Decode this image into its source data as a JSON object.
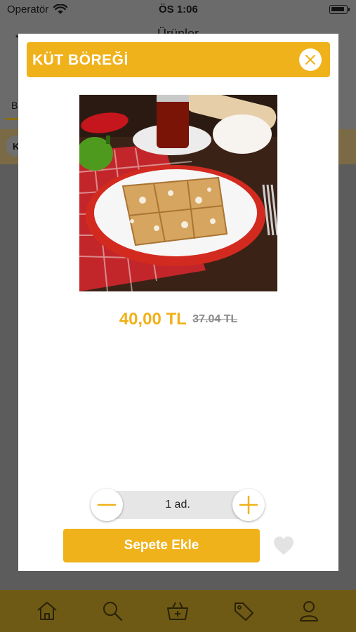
{
  "status_bar": {
    "carrier": "Operatör",
    "time": "ÖS 1:06"
  },
  "background": {
    "nav_title": "Ürünler",
    "tab_letter": "B",
    "chip_letter": "K"
  },
  "tab_bar": {
    "items": [
      {
        "icon": "home-icon"
      },
      {
        "icon": "search-icon"
      },
      {
        "icon": "basket-icon"
      },
      {
        "icon": "tag-icon"
      },
      {
        "icon": "user-icon"
      }
    ]
  },
  "modal": {
    "title": "KÜT BÖREĞİ",
    "price": "40,00 TL",
    "old_price": "37.04 TL",
    "quantity": "1 ad.",
    "add_to_cart_label": "Sepete Ekle"
  },
  "colors": {
    "accent": "#f0b21b",
    "overlay": "#5c5c5c",
    "old_price": "#8a8a8a"
  }
}
